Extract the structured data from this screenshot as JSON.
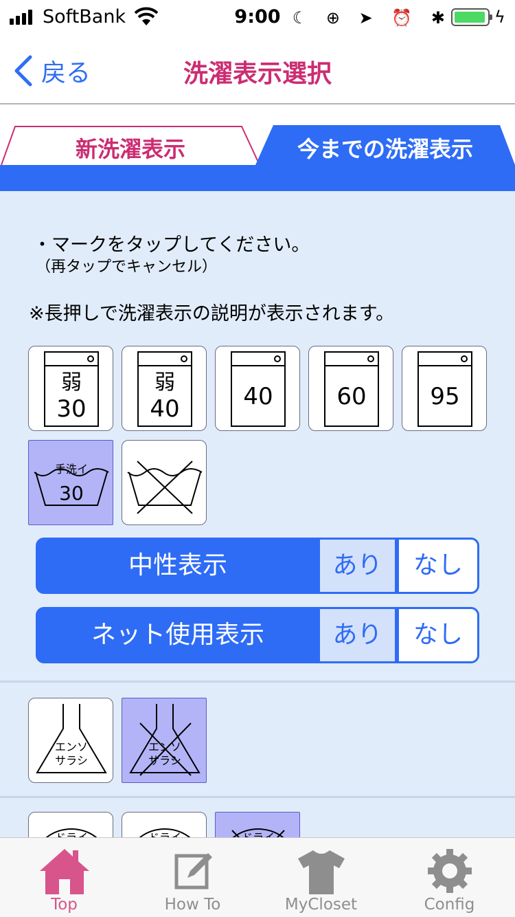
{
  "status_bar": {
    "carrier": "SoftBank",
    "time": "9:00",
    "indicators": "☾ ⊕ ➤ ⏰ ✱",
    "charging": "ϟ",
    "battery_color": "#4cd964"
  },
  "nav": {
    "back_label": "戻る",
    "title": "洗濯表示選択"
  },
  "tabs": {
    "new_label": "新洗濯表示",
    "old_label": "今までの洗濯表示",
    "active": "old",
    "accent_color": "#2e6cf6",
    "pink_color": "#cc2d72"
  },
  "instructions": {
    "line1": "・マークをタップしてください。",
    "line2": "（再タップでキャンセル）",
    "line3": "※長押しで洗濯表示の説明が表示されます。"
  },
  "wash_marks": [
    {
      "top": "弱",
      "bottom": "30",
      "selected": false
    },
    {
      "top": "弱",
      "bottom": "40",
      "selected": false
    },
    {
      "top": "",
      "bottom": "40",
      "selected": false
    },
    {
      "top": "",
      "bottom": "60",
      "selected": false
    },
    {
      "top": "",
      "bottom": "95",
      "selected": false
    }
  ],
  "hand_wash": {
    "label": "手洗イ",
    "temp": "30",
    "selected": true
  },
  "no_wash": {
    "selected": false
  },
  "toggles": [
    {
      "label": "中性表示",
      "yes": "あり",
      "no": "なし",
      "value": "あり"
    },
    {
      "label": "ネット使用表示",
      "yes": "あり",
      "no": "なし",
      "value": "あり"
    }
  ],
  "bleach_marks": [
    {
      "line1": "エンソ",
      "line2": "サラシ",
      "selected": false,
      "crossed": false
    },
    {
      "line1": "エンソ",
      "line2": "サラシ",
      "selected": true,
      "crossed": true
    }
  ],
  "dry_marks": [
    {
      "label": "ドライ",
      "selected": false
    },
    {
      "label": "ドライ",
      "selected": false
    },
    {
      "label": "ドライ",
      "selected": true
    }
  ],
  "tab_bar": {
    "items": [
      {
        "label": "Top",
        "icon": "house-icon",
        "active": true
      },
      {
        "label": "How To",
        "icon": "edit-icon",
        "active": false
      },
      {
        "label": "MyCloset",
        "icon": "tshirt-icon",
        "active": false
      },
      {
        "label": "Config",
        "icon": "gear-icon",
        "active": false
      }
    ],
    "active_color": "#d8558b"
  }
}
